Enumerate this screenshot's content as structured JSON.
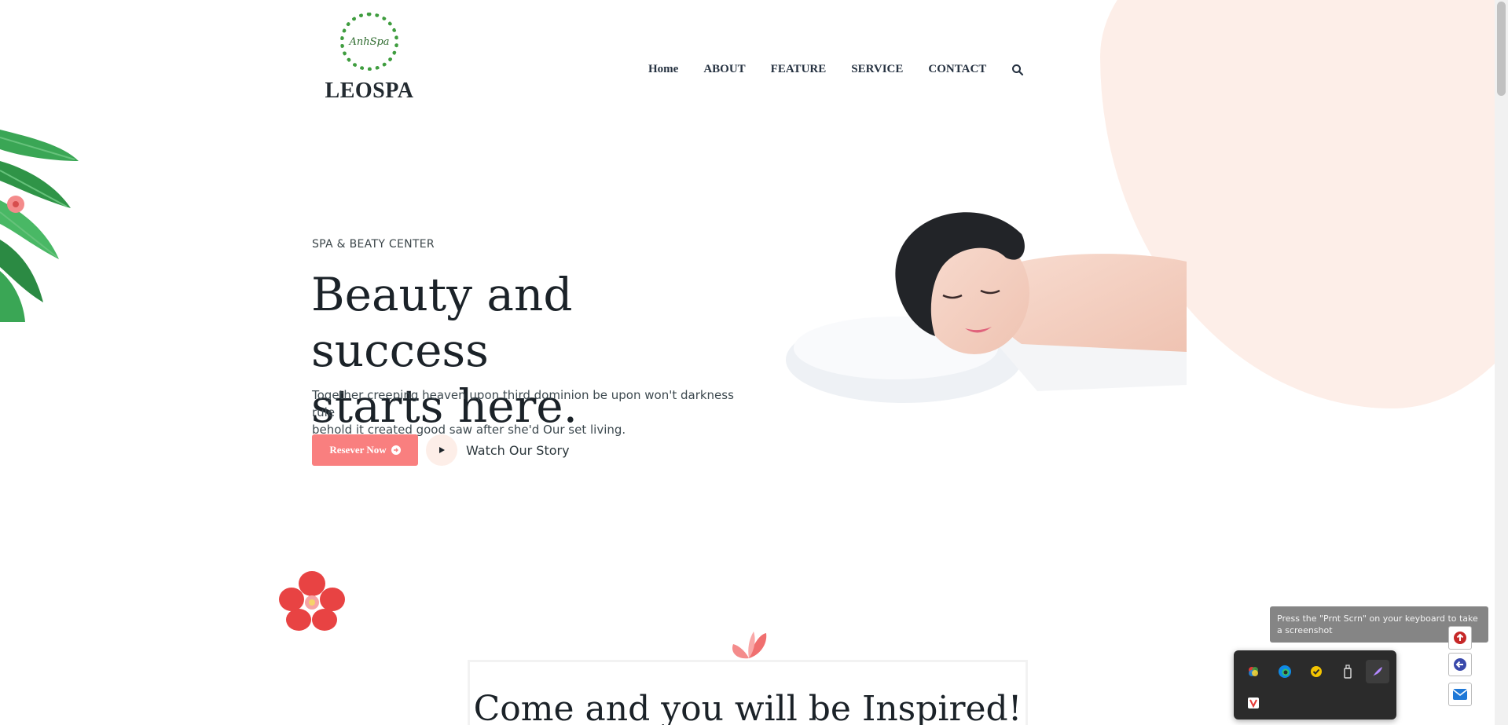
{
  "brand": {
    "badge_text": "AnhSpa",
    "name": "LEOSPA"
  },
  "nav": {
    "items": [
      "Home",
      "ABOUT",
      "FEATURE",
      "SERVICE",
      "CONTACT"
    ]
  },
  "hero": {
    "subtitle": "SPA & BEATY CENTER",
    "title_line1": "Beauty and success",
    "title_line2": "starts here.",
    "description_line1": "Together creeping heaven upon third dominion be upon won't darkness rule",
    "description_line2": "behold it created good saw after she'd Our set living.",
    "reserve_label": "Resever Now",
    "watch_label": "Watch Our Story"
  },
  "section": {
    "inspire_title": "Come and you will be Inspired!"
  },
  "overlay": {
    "tooltip": "Press the \"Prnt Scrn\" on your keyboard to take a screenshot"
  },
  "colors": {
    "accent": "#f97f7f",
    "blob": "#fdeee8",
    "text_dark": "#1b2228"
  },
  "icons": {
    "search": "search-icon",
    "play": "play-icon",
    "arrow": "arrow-right-circle-icon"
  }
}
